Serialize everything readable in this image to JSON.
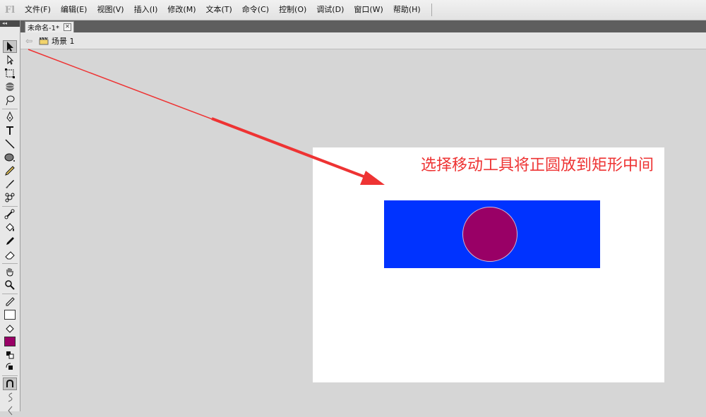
{
  "app": {
    "logo": "Fl"
  },
  "menu": {
    "items": [
      "文件(F)",
      "编辑(E)",
      "视图(V)",
      "插入(I)",
      "修改(M)",
      "文本(T)",
      "命令(C)",
      "控制(O)",
      "调试(D)",
      "窗口(W)",
      "帮助(H)"
    ]
  },
  "toolbar": {
    "collapse_label": "◂◂"
  },
  "document": {
    "tab_title": "未命名-1*",
    "close_glyph": "✕"
  },
  "editbar": {
    "scene_label": "场景 1"
  },
  "stage": {
    "rect_color": "#0033ff",
    "circle_color": "#990066",
    "fill_color": "#990066",
    "stroke_color": "#ffffff"
  },
  "annotation": {
    "text": "选择移动工具将正圆放到矩形中间",
    "color": "#ee3333"
  }
}
